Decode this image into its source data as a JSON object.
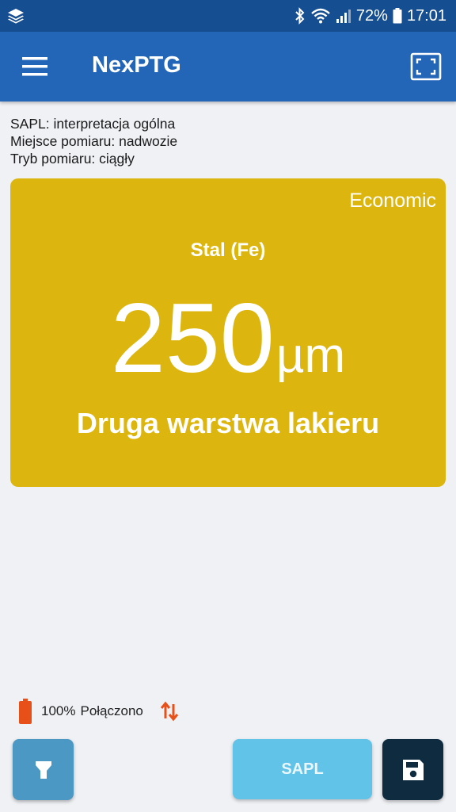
{
  "status_bar": {
    "battery_percent": "72%",
    "time": "17:01",
    "icons": [
      "layers-icon",
      "bluetooth-icon",
      "wifi-icon",
      "signal-icon",
      "battery-icon"
    ]
  },
  "app_bar": {
    "title": "NexPTG",
    "menu_icon": "hamburger-menu-icon",
    "action_icon": "fullscreen-icon"
  },
  "info": {
    "lines": [
      "SAPL: interpretacja ogólna",
      "Miejsce pomiaru: nadwozie",
      "Tryb pomiaru: ciągły"
    ]
  },
  "measurement": {
    "mode": "Economic",
    "material": "Stal (Fe)",
    "value": "250",
    "unit": "µm",
    "interpretation": "Druga warstwa lakieru",
    "card_color": "#dcb60f"
  },
  "device": {
    "battery": "100%",
    "connection": "Połączono",
    "battery_color": "#e8501a",
    "transfer_color": "#e8501a"
  },
  "buttons": {
    "flashlight_icon": "flashlight-icon",
    "sapl_label": "SAPL",
    "save_icon": "save-icon"
  }
}
